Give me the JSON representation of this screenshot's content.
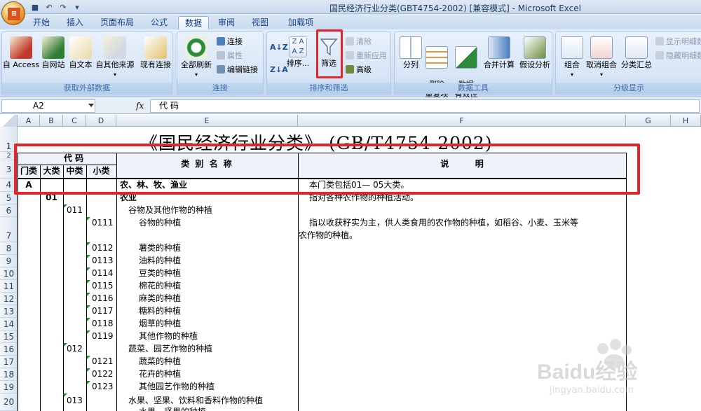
{
  "window": {
    "title": "国民经济行业分类(GBT4754-2002)  [兼容模式] - Microsoft Excel"
  },
  "tabs": [
    "开始",
    "插入",
    "页面布局",
    "公式",
    "数据",
    "审阅",
    "视图",
    "加载项"
  ],
  "active_tab": "数据",
  "ribbon": {
    "get_external": {
      "label": "获取外部数据",
      "buttons": [
        "自 Access",
        "自网站",
        "自文本",
        "自其他来源",
        "现有连接"
      ]
    },
    "connections": {
      "label": "连接",
      "refresh_all": "全部刷新",
      "items": [
        "连接",
        "属性",
        "编辑链接"
      ]
    },
    "sort_filter": {
      "label": "排序和筛选",
      "sort_az": "A↓Z",
      "sort_za": "Z↓A",
      "sort": "排序...",
      "filter": "筛选",
      "items": [
        "清除",
        "重新应用",
        "高级"
      ]
    },
    "data_tools": {
      "label": "数据工具",
      "buttons": [
        "分列",
        "删除\n重复项",
        "数据\n有效性",
        "合并计算",
        "假设分析"
      ]
    },
    "outline": {
      "label": "分级显示",
      "buttons": [
        "组合",
        "取消组合",
        "分类汇总"
      ],
      "items": [
        "显示明细数",
        "隐藏明细数"
      ]
    }
  },
  "formula_bar": {
    "name_box": "A2",
    "fx": "fx",
    "content": "代        码"
  },
  "columns": [
    "A",
    "B",
    "C",
    "D",
    "E",
    "F",
    "G",
    "H"
  ],
  "rows": [
    "1",
    "2",
    "3",
    "4",
    "5",
    "6",
    "7",
    "8",
    "9",
    "10",
    "11",
    "12",
    "13",
    "14",
    "15",
    "16",
    "17",
    "18",
    "19",
    "20"
  ],
  "sheet": {
    "title": "《国民经济行业分类》 (GB/T4754-2002)",
    "header_code": "代    码",
    "header_code_sub": [
      "门类",
      "大类",
      "中类",
      "小类"
    ],
    "header_name": "类 别 名 称",
    "header_desc": "说         明",
    "rows": [
      {
        "a": "A",
        "b": "",
        "c": "",
        "d": "",
        "name": "农、林、牧、渔业",
        "desc": "本门类包括01— 05大类。"
      },
      {
        "a": "",
        "b": "01",
        "c": "",
        "d": "",
        "name": "农业",
        "desc": "指对各种农作物的种植活动。"
      },
      {
        "a": "",
        "b": "",
        "c": "011",
        "d": "",
        "name": "谷物及其他作物的种植",
        "desc": ""
      },
      {
        "a": "",
        "b": "",
        "c": "",
        "d": "0111",
        "name": "谷物的种植",
        "desc": "指以收获籽实为主，供人类食用的农作物的种植，如稻谷、小麦、玉米等",
        "desc2": "农作物的种植。"
      },
      {
        "a": "",
        "b": "",
        "c": "",
        "d": "0112",
        "name": "薯类的种植",
        "desc": ""
      },
      {
        "a": "",
        "b": "",
        "c": "",
        "d": "0113",
        "name": "油料的种植",
        "desc": ""
      },
      {
        "a": "",
        "b": "",
        "c": "",
        "d": "0114",
        "name": "豆类的种植",
        "desc": ""
      },
      {
        "a": "",
        "b": "",
        "c": "",
        "d": "0115",
        "name": "棉花的种植",
        "desc": ""
      },
      {
        "a": "",
        "b": "",
        "c": "",
        "d": "0116",
        "name": "麻类的种植",
        "desc": ""
      },
      {
        "a": "",
        "b": "",
        "c": "",
        "d": "0117",
        "name": "糖料的种植",
        "desc": ""
      },
      {
        "a": "",
        "b": "",
        "c": "",
        "d": "0118",
        "name": "烟草的种植",
        "desc": ""
      },
      {
        "a": "",
        "b": "",
        "c": "",
        "d": "0119",
        "name": "其他作物的种植",
        "desc": ""
      },
      {
        "a": "",
        "b": "",
        "c": "012",
        "d": "",
        "name": "蔬菜、园艺作物的种植",
        "desc": ""
      },
      {
        "a": "",
        "b": "",
        "c": "",
        "d": "0121",
        "name": "蔬菜的种植",
        "desc": ""
      },
      {
        "a": "",
        "b": "",
        "c": "",
        "d": "0122",
        "name": "花卉的种植",
        "desc": ""
      },
      {
        "a": "",
        "b": "",
        "c": "",
        "d": "0123",
        "name": "其他园艺作物的种植",
        "desc": ""
      },
      {
        "a": "",
        "b": "",
        "c": "013",
        "d": "",
        "name": "水果、坚果、饮料和香料作物的种植",
        "desc": ""
      },
      {
        "a": "",
        "b": "",
        "c": "",
        "d": "",
        "name": "水果、坚果的种植",
        "desc": ""
      }
    ]
  },
  "watermark": {
    "brand": "Baidu经验",
    "url": "jingyan.baidu.com"
  },
  "colors": {
    "highlight": "#e0262b",
    "ribbon": "#d2e1f4",
    "accent": "#15428b"
  }
}
